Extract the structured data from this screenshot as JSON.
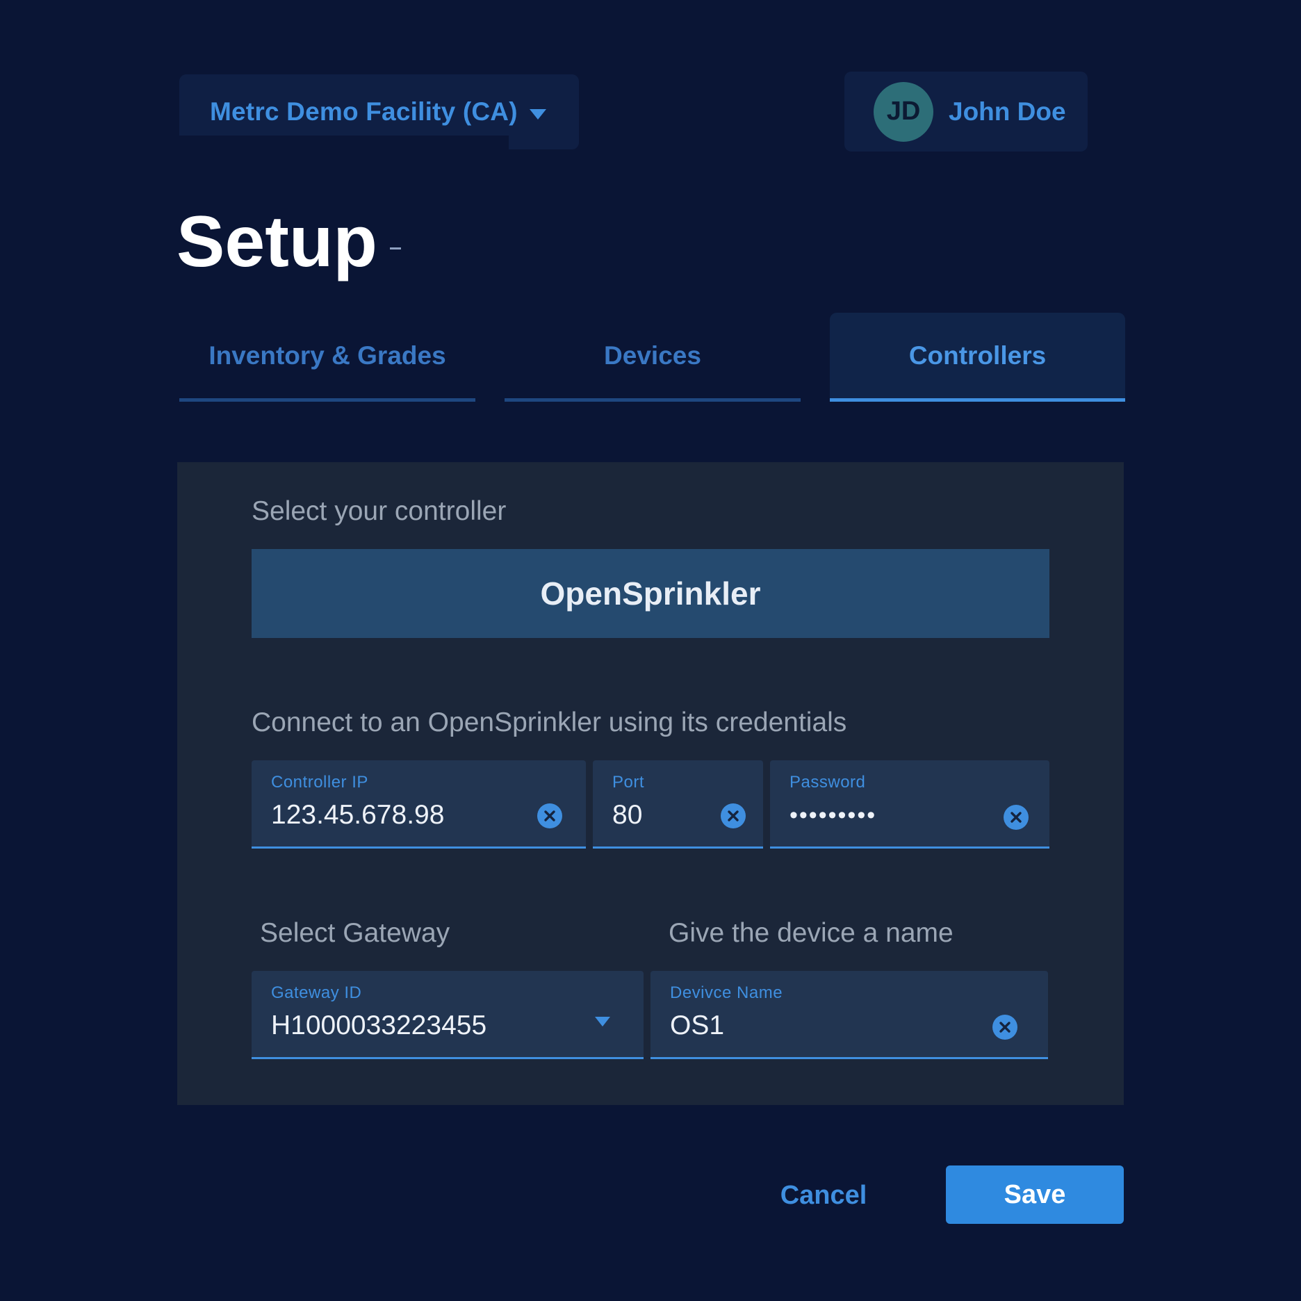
{
  "header": {
    "facility": {
      "label": "Metrc Demo Facility (CA)",
      "icon": "chevron-down-icon"
    },
    "user": {
      "initials": "JD",
      "name": "John Doe"
    }
  },
  "page": {
    "title": "Setup"
  },
  "tabs": [
    {
      "label": "Inventory & Grades",
      "active": false
    },
    {
      "label": "Devices",
      "active": false
    },
    {
      "label": "Controllers",
      "active": true
    }
  ],
  "controller_section": {
    "label": "Select your controller",
    "selected_controller": "OpenSprinkler"
  },
  "credentials_section": {
    "label": "Connect to an OpenSprinkler using its credentials",
    "controller_ip": {
      "label": "Controller IP",
      "value": "123.45.678.98"
    },
    "port": {
      "label": "Port",
      "value": "80"
    },
    "password": {
      "label": "Password",
      "value": "•••••••••"
    }
  },
  "gateway_section": {
    "label": "Select Gateway",
    "gateway_id": {
      "label": "Gateway ID",
      "value": "H1000033223455"
    }
  },
  "name_section": {
    "label": "Give the device a name",
    "device_name": {
      "label": "Devivce Name",
      "value": "OS1"
    }
  },
  "actions": {
    "cancel": "Cancel",
    "save": "Save"
  },
  "colors": {
    "background": "#0a1535",
    "panel": "#1b2639",
    "accent": "#3f8fe0",
    "primary_button": "#2f8ae0"
  }
}
